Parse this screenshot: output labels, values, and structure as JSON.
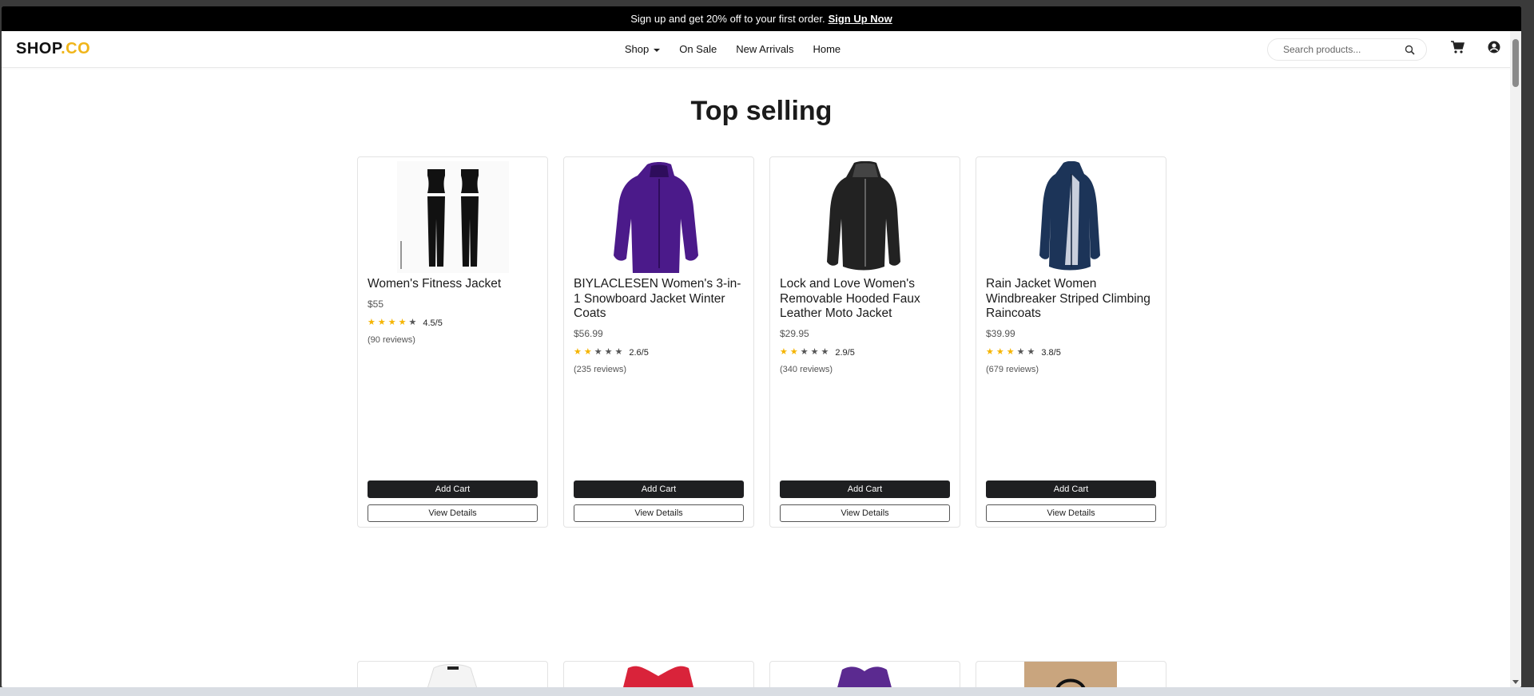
{
  "promo": {
    "text": "Sign up and get 20% off to your first order.",
    "link": "Sign Up Now"
  },
  "nav": {
    "logo_main": "SHOP",
    "logo_accent": ".CO",
    "items": [
      {
        "label": "Shop",
        "has_caret": true
      },
      {
        "label": "On Sale"
      },
      {
        "label": "New Arrivals"
      },
      {
        "label": "Home"
      }
    ],
    "search_placeholder": "Search products...",
    "icons": [
      "search-icon",
      "cart-icon",
      "user-icon"
    ]
  },
  "section": {
    "title": "Top selling"
  },
  "products": [
    {
      "name": "Women's Fitness Jacket",
      "price": "$55",
      "rating": 4.5,
      "rating_text": "4.5/5",
      "reviews": "(90 reviews)",
      "add_label": "Add Cart",
      "details_label": "View Details",
      "image": "black-fitness-set"
    },
    {
      "name": "BIYLACLESEN Women's 3-in-1 Snowboard Jacket Winter Coats",
      "price": "$56.99",
      "rating": 2.6,
      "rating_text": "2.6/5",
      "reviews": "(235 reviews)",
      "add_label": "Add Cart",
      "details_label": "View Details",
      "image": "purple-jacket"
    },
    {
      "name": "Lock and Love Women's Removable Hooded Faux Leather Moto Jacket",
      "price": "$29.95",
      "rating": 2.9,
      "rating_text": "2.9/5",
      "reviews": "(340 reviews)",
      "add_label": "Add Cart",
      "details_label": "View Details",
      "image": "black-leather-jacket"
    },
    {
      "name": "Rain Jacket Women Windbreaker Striped Climbing Raincoats",
      "price": "$39.99",
      "rating": 3.8,
      "rating_text": "3.8/5",
      "reviews": "(679 reviews)",
      "add_label": "Add Cart",
      "details_label": "View Details",
      "image": "navy-raincoat"
    }
  ],
  "colors": {
    "promo_bg": "#000000",
    "accent": "#f0b51a",
    "star": "#f5b400",
    "button_dark": "#1e1f21"
  }
}
